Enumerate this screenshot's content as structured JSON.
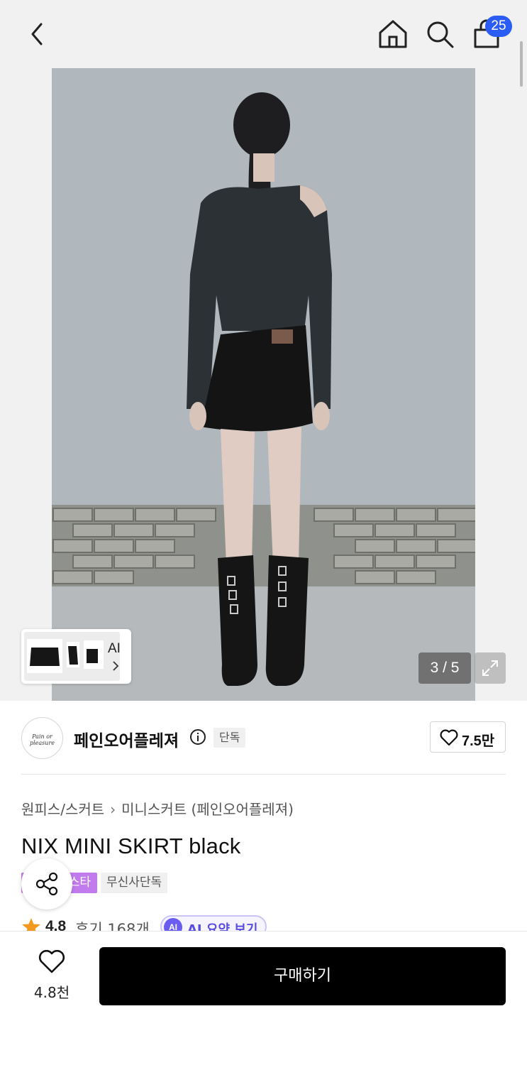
{
  "header": {
    "cart_count": "25",
    "icons": [
      "chevron-left-icon",
      "home-icon",
      "search-icon",
      "shopping-bag-icon"
    ]
  },
  "gallery": {
    "counter": "3 / 5",
    "ai_label": "AI"
  },
  "brand": {
    "logo_text": "Pain or pleasure",
    "name": "페인오어플레져",
    "exclusive_tag": "단독",
    "likes": "7.5만"
  },
  "product": {
    "breadcrumb": [
      "원피스/스커트",
      "미니스커트 (페인오어플레져)"
    ],
    "title": "NIX MINI SKIRT black",
    "tags": {
      "purple": "스타",
      "gray": "무신사단독"
    },
    "rating": "4.8",
    "reviews": "후기 168개",
    "ai_summary_dot": "AI",
    "ai_summary": "AI 요약 보기"
  },
  "bottom_bar": {
    "wish_count": "4.8천",
    "buy_label": "구매하기"
  },
  "colors": {
    "accent_blue": "#2b5cf6",
    "tag_purple": "#c27bec",
    "ai_purple": "#6a5cf0",
    "star_orange": "#f29a1f"
  }
}
